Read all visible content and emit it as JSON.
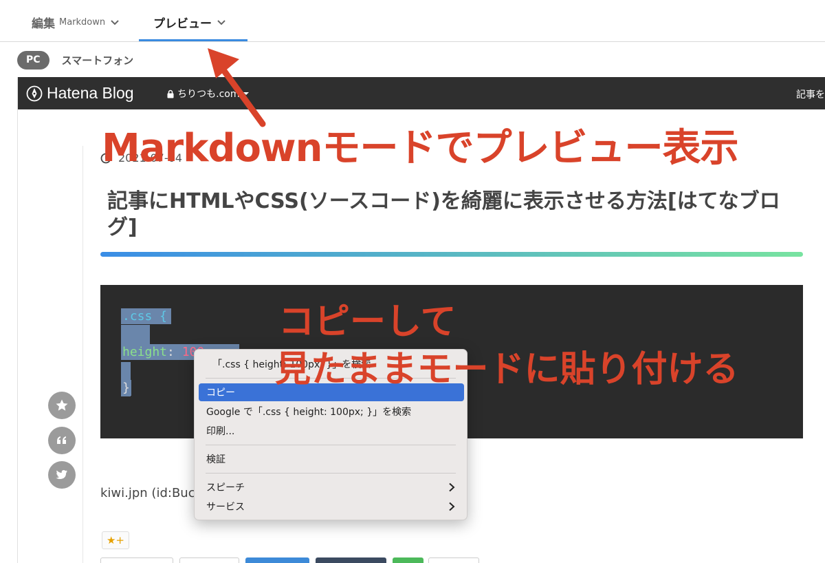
{
  "tabs": {
    "edit_label": "編集",
    "edit_sub": "Markdown",
    "preview_label": "プレビュー"
  },
  "device": {
    "pc_label": "PC",
    "smartphone_label": "スマートフォン"
  },
  "hatena_bar": {
    "logo_text": "Hatena Blog",
    "blog_name": "ちりつも.com",
    "right_text": "記事を"
  },
  "article": {
    "date": "2021-07-04",
    "title": "記事にHTMLやCSS(ソースコード)を綺麗に表示させる方法[はてなブログ]",
    "code_line1": ".css {",
    "code_line2_prop": "height",
    "code_line2_colon": ": ",
    "code_line2_value": "100",
    "code_line3": "}",
    "author": "kiwi.jpn (id:Buc",
    "star_button": "★+"
  },
  "context_menu": {
    "header": "「.css {  height: 100px;  }」を検索",
    "copy": "コピー",
    "google_search": "Google で「.css {  height: 100px;  }」を検索",
    "print": "印刷...",
    "inspect": "検証",
    "speech": "スピーチ",
    "services": "サービス"
  },
  "annotations": {
    "main": "Markdownモードでプレビュー表示",
    "copy": "コピーして",
    "paste": "見たままモードに貼り付ける"
  },
  "colors": {
    "annotation": "#d9432a",
    "tab_active_underline": "#3a8be0",
    "menu_highlight": "#3a72d7",
    "code_bg": "#2b2b2b",
    "selection": "#6a86ab"
  }
}
